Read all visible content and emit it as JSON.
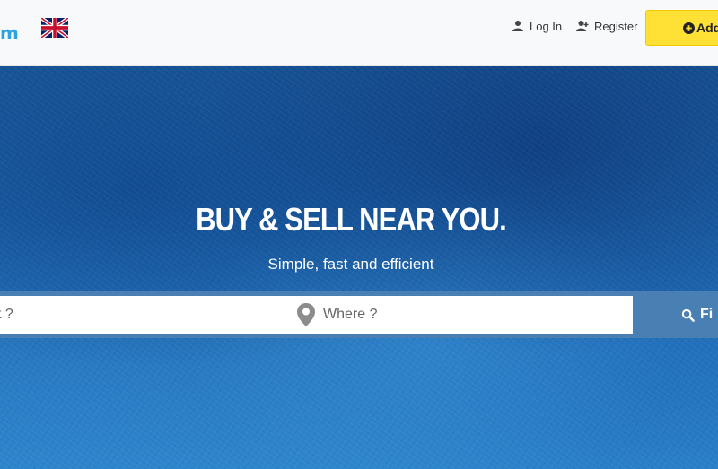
{
  "header": {
    "logo_fragment": "m",
    "language": {
      "flag": "uk-flag-icon"
    },
    "login_label": "Log In",
    "register_label": "Register",
    "add_button_label": "Add",
    "colors": {
      "accent": "#ffe135",
      "logo": "#2ba3e0"
    }
  },
  "hero": {
    "headline": "BUY & SELL NEAR YOU.",
    "subline": "Simple, fast and efficient"
  },
  "search": {
    "what_placeholder": "t ?",
    "where_placeholder": "Where ?",
    "find_label": "Fi",
    "bar_color": "#4a7fb3"
  }
}
